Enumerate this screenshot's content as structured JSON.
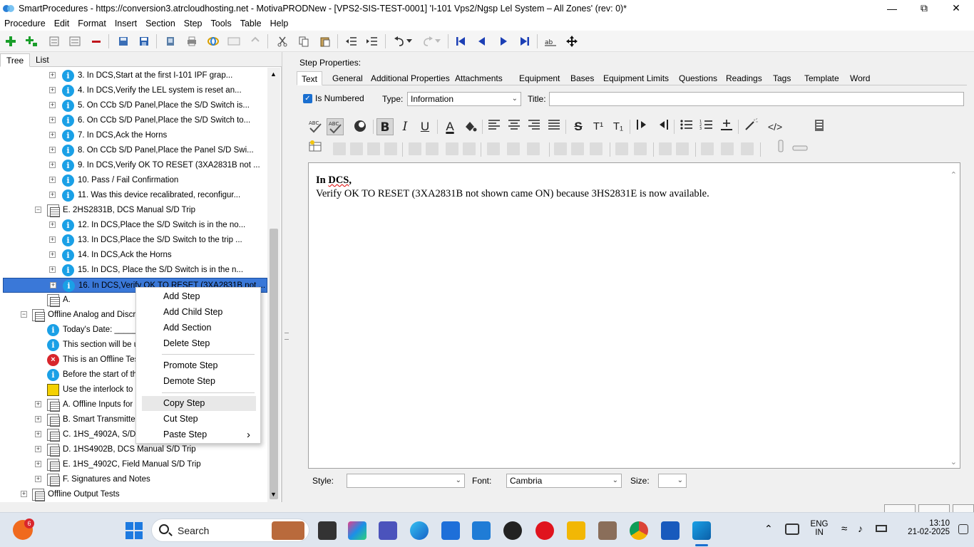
{
  "window": {
    "title": "SmartProcedures - https://conversion3.atrcloudhosting.net - MotivaPRODNew - [VPS2-SIS-TEST-0001] 'I-101 Vps2/Ngsp Lel System – All Zones' (rev: 0)*",
    "minimize": "—",
    "maximize": "⧉",
    "close": "✕"
  },
  "menu": [
    "Procedure",
    "Edit",
    "Format",
    "Insert",
    "Section",
    "Step",
    "Tools",
    "Table",
    "Help"
  ],
  "left_tabs": {
    "tree": "Tree",
    "list": "List"
  },
  "tree": [
    {
      "indent": 2,
      "icon": "info",
      "expander": "+",
      "label": "3. In DCS,Start at the first I-101 IPF grap..."
    },
    {
      "indent": 2,
      "icon": "info",
      "expander": "+",
      "label": "4. In DCS,Verify the LEL system is reset an..."
    },
    {
      "indent": 2,
      "icon": "info",
      "expander": "+",
      "label": "5. On CCb S/D Panel,Place the S/D Switch is..."
    },
    {
      "indent": 2,
      "icon": "info",
      "expander": "+",
      "label": "6. On CCb S/D Panel,Place the S/D Switch to..."
    },
    {
      "indent": 2,
      "icon": "info",
      "expander": "+",
      "label": "7. In DCS,Ack the Horns"
    },
    {
      "indent": 2,
      "icon": "info",
      "expander": "+",
      "label": "8. On CCb S/D Panel,Place the Panel S/D Swi..."
    },
    {
      "indent": 2,
      "icon": "info",
      "expander": "+",
      "label": "9. In DCS,Verify OK TO RESET (3XA2831B not ..."
    },
    {
      "indent": 2,
      "icon": "info",
      "expander": "+",
      "label": "10. Pass / Fail Confirmation"
    },
    {
      "indent": 2,
      "icon": "info",
      "expander": "+",
      "label": "11. Was this device recalibrated, reconfigur..."
    },
    {
      "indent": 1,
      "icon": "section",
      "expander": "−",
      "label": "E. 2HS2831B, DCS Manual S/D Trip"
    },
    {
      "indent": 2,
      "icon": "info",
      "expander": "+",
      "label": "12. In DCS,Place the S/D Switch is in the no..."
    },
    {
      "indent": 2,
      "icon": "info",
      "expander": "+",
      "label": "13. In DCS,Place the S/D Switch to the trip ..."
    },
    {
      "indent": 2,
      "icon": "info",
      "expander": "+",
      "label": "14. In DCS,Ack the Horns"
    },
    {
      "indent": 2,
      "icon": "info",
      "expander": "+",
      "label": "15. In DCS, Place the S/D Switch is in the n..."
    },
    {
      "indent": 2,
      "icon": "info",
      "expander": "+",
      "label": "16. In DCS,Verify OK TO RESET (3XA2831B not ...",
      "selected": true
    },
    {
      "indent": 1,
      "icon": "section",
      "expander": "",
      "label": "A."
    },
    {
      "indent": 0,
      "icon": "section",
      "expander": "−",
      "label": "Offline Analog and Discre"
    },
    {
      "indent": 1,
      "icon": "info",
      "expander": "",
      "label": "Today's Date: ______"
    },
    {
      "indent": 1,
      "icon": "info",
      "expander": "",
      "label": "This section will be us"
    },
    {
      "indent": 1,
      "icon": "error",
      "expander": "",
      "label": "This is an Offline Test"
    },
    {
      "indent": 1,
      "icon": "info",
      "expander": "",
      "label": "Before the start of th"
    },
    {
      "indent": 1,
      "icon": "interlock",
      "expander": "",
      "label": "Use the interlock to ir"
    },
    {
      "indent": 1,
      "icon": "section",
      "expander": "+",
      "label": "A. Offline Inputs for"
    },
    {
      "indent": 1,
      "icon": "section",
      "expander": "+",
      "label": "B. Smart Transmitter"
    },
    {
      "indent": 1,
      "icon": "section",
      "expander": "+",
      "label": "C. 1HS_4902A, S/D F"
    },
    {
      "indent": 1,
      "icon": "section",
      "expander": "+",
      "label": "D. 1HS4902B, DCS Manual S/D Trip"
    },
    {
      "indent": 1,
      "icon": "section",
      "expander": "+",
      "label": "E. 1HS_4902C, Field Manual S/D Trip"
    },
    {
      "indent": 1,
      "icon": "section",
      "expander": "+",
      "label": "F. Signatures and Notes"
    },
    {
      "indent": 0,
      "icon": "section",
      "expander": "+",
      "label": "Offline Output Tests"
    }
  ],
  "context_menu": {
    "items": [
      "Add Step",
      "Add Child Step",
      "Add Section",
      "Delete Step",
      "Promote Step",
      "Demote Step",
      "Copy Step",
      "Cut Step",
      "Paste Step"
    ],
    "submenu_arrow": "›"
  },
  "step_properties": {
    "heading": "Step Properties:",
    "tabs": [
      "Text",
      "General",
      "Additional Properties",
      "Attachments",
      "Equipment",
      "Bases",
      "Equipment Limits",
      "Questions",
      "Readings",
      "Tags",
      "Template",
      "Word"
    ],
    "is_numbered_label": "Is Numbered",
    "is_numbered_checkmark": "✓",
    "type_label": "Type:",
    "type_value": "Information",
    "title_label": "Title:",
    "title_value": ""
  },
  "format_glyphs": {
    "bold": "B",
    "italic": "I",
    "underline": "U",
    "font_color": "A",
    "strike": "S",
    "superscript": "T¹",
    "subscript": "T₁",
    "code": "</>"
  },
  "editor": {
    "line1_prefix": "In ",
    "line1_word": "DCS",
    "line1_suffix": ",",
    "line2": "Verify OK TO RESET (3XA2831B not shown came ON) because 3HS2831E is now available."
  },
  "bottom": {
    "style_label": "Style:",
    "style_value": "",
    "font_label": "Font:",
    "font_value": "Cambria",
    "size_label": "Size:",
    "size_value": ""
  },
  "taskbar": {
    "search_placeholder": "Search",
    "notification_badge": "6",
    "language_line1": "ENG",
    "language_line2": "IN",
    "time": "13:10",
    "date": "21-02-2025"
  },
  "colors": {
    "selection": "#3a78d8",
    "info_icon": "#1aa0e6",
    "error_icon": "#d8262c",
    "checkbox": "#1a6fd0"
  }
}
